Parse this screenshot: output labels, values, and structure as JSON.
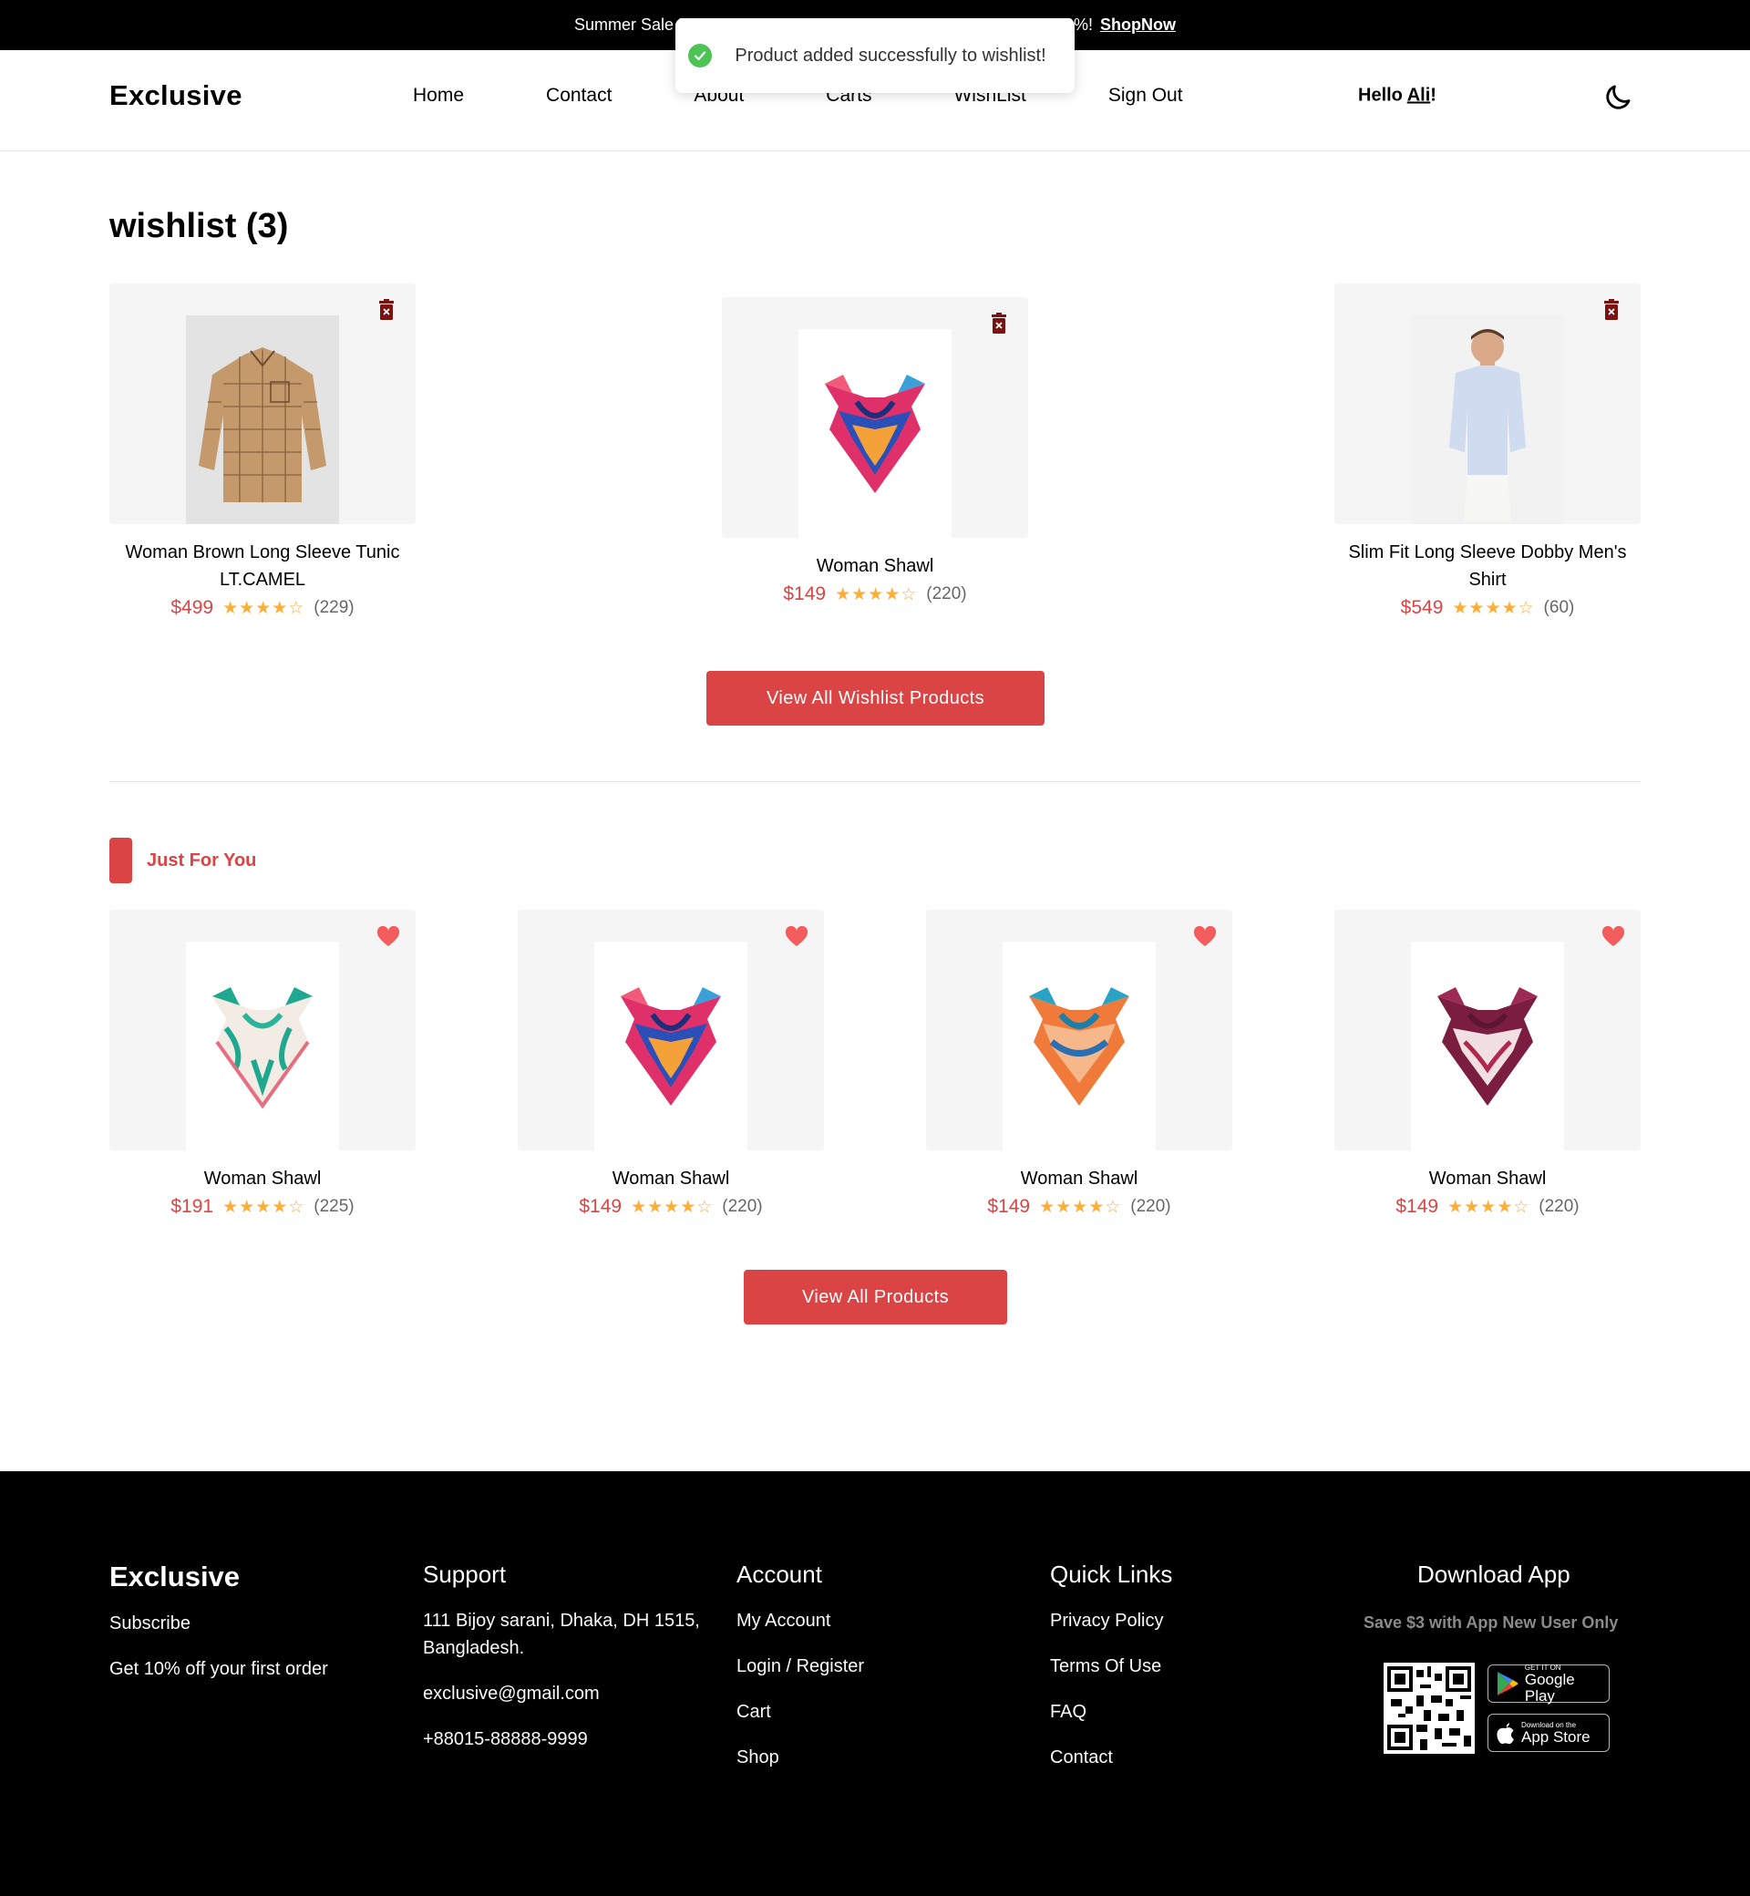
{
  "banner": {
    "text_visible_start": "Summer Sale F",
    "text_visible_end": "0%!",
    "shop_link": "ShopNow"
  },
  "toast": {
    "message": "Product added successfully to wishlist!",
    "status_color": "#4cc354"
  },
  "header": {
    "logo": "Exclusive",
    "nav": [
      "Home",
      "Contact",
      "About",
      "Carts",
      "WishList",
      "Sign Out"
    ],
    "greeting_prefix": "Hello ",
    "user": "Ali",
    "greeting_suffix": "!",
    "theme_icon": "moon-icon"
  },
  "wishlist": {
    "title": "wishlist (3)",
    "items": [
      {
        "name": "Woman Brown Long Sleeve Tunic LT.CAMEL",
        "price": "$499",
        "rating": 4.5,
        "reviews": "(229)",
        "image": "brown-plaid-shirt"
      },
      {
        "name": "Woman Shawl",
        "price": "$149",
        "rating": 4.5,
        "reviews": "(220)",
        "image": "scarf-multicolor"
      },
      {
        "name": "Slim Fit Long Sleeve Dobby Men's Shirt",
        "price": "$549",
        "rating": 4.5,
        "reviews": "(60)",
        "image": "man-blue-shirt"
      }
    ],
    "button": "View All Wishlist Products"
  },
  "just_for_you": {
    "label": "Just For You",
    "items": [
      {
        "name": "Woman Shawl",
        "price": "$191",
        "rating": 4.5,
        "reviews": "(225)",
        "image": "scarf-teal-white"
      },
      {
        "name": "Woman Shawl",
        "price": "$149",
        "rating": 4.5,
        "reviews": "(220)",
        "image": "scarf-multicolor"
      },
      {
        "name": "Woman Shawl",
        "price": "$149",
        "rating": 4.5,
        "reviews": "(220)",
        "image": "scarf-orange-blue"
      },
      {
        "name": "Woman Shawl",
        "price": "$149",
        "rating": 4.5,
        "reviews": "(220)",
        "image": "scarf-burgundy"
      }
    ],
    "button": "View All Products"
  },
  "footer": {
    "logo": "Exclusive",
    "subscribe": "Subscribe",
    "offer": "Get 10% off your first order",
    "support": {
      "title": "Support",
      "address_line1": "111 Bijoy sarani, Dhaka, DH 1515,",
      "address_line2": "Bangladesh.",
      "email": "exclusive@gmail.com",
      "phone": "+88015-88888-9999"
    },
    "account": {
      "title": "Account",
      "items": [
        "My Account",
        "Login / Register",
        "Cart",
        "Shop"
      ]
    },
    "quick_links": {
      "title": "Quick Links",
      "items": [
        "Privacy Policy",
        "Terms Of Use",
        "FAQ",
        "Contact"
      ]
    },
    "download": {
      "title": "Download App",
      "subtitle": "Save $3 with App New User Only",
      "google_small": "GET IT ON",
      "google_big": "Google Play",
      "apple_small": "Download on the",
      "apple_big": "App Store"
    }
  },
  "colors": {
    "accent": "#db4444",
    "star": "#ffad33",
    "card_bg": "#f5f5f5"
  }
}
